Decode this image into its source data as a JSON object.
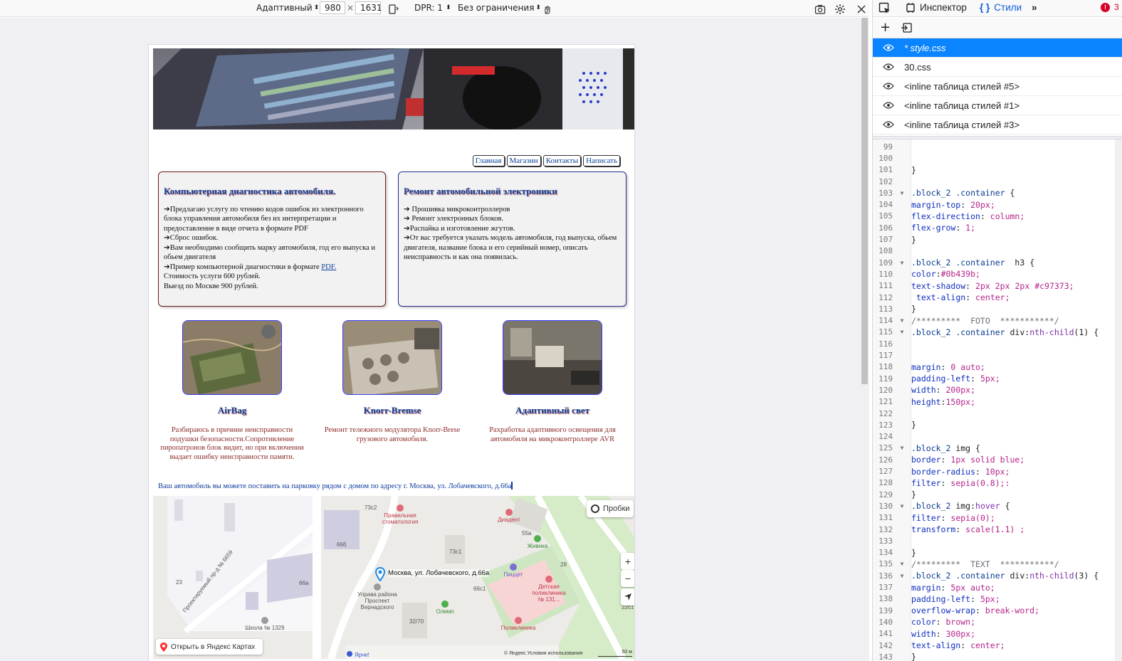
{
  "rdm": {
    "device": "Адаптивный",
    "width": "980",
    "times": "×",
    "height": "1631",
    "dpr": "DPR: 1",
    "throttle": "Без ограничения"
  },
  "site": {
    "nav": [
      "Главная",
      "Магазин",
      "Контакты",
      "Написать"
    ],
    "card_diag": {
      "title": "Компьютерная диагностика автомобиля.",
      "lines": [
        "➔Предлагаю услугу по чтению кодов ошибок из электронного блока управления автомобиля без их интерпретации и предоставление в виде отчета в формате PDF",
        "➔Сброс ошибок.",
        "➔Вам необходимо сообщить марку автомобиля, год его выпуска и обьем двигателя"
      ],
      "pdf_prefix": "➔Пример компьютерной диагностики в формате ",
      "pdf_link": "PDF.",
      "price1": "Стоимость услуги 600 рублей.",
      "price2": "Выезд по Москве 900 рублей."
    },
    "card_repair": {
      "title": "Ремонт автомобильной электроники",
      "lines": [
        "➔ Прошивка микроконтроллеров",
        "➔ Ремонт электронных блоков.",
        "➔Распайка и изготовление жгутов.",
        "➔От вас требуется указать модель автомобиля, год выпуска, обьем двигателя, название блока и его серийный номер, описать неисправность и как она появилась."
      ]
    },
    "photos": [
      {
        "title": "AirBag",
        "text": "Разбираюсь в причине неисправности подушки безопасности.Сопротивление пиропатронов блок видит, но при включении выдает ошибку неисправности памяти."
      },
      {
        "title": "Knorr-Bremse",
        "text": "Ремонт тележного модулятора Knorr-Brese грузового автомобиля."
      },
      {
        "title": "Адаптивный свет",
        "text": "Рахработка адаптивного освещения для автомобиля на микроконтроллере AVR"
      }
    ],
    "address": "Ваш автомобиль вы можете поставить на парковку рядом с домом по адресу г. Москва, ул. Лобачевского, д.66а",
    "map": {
      "marker_label": "Москва, ул. Лобачевского, д.66а",
      "traffic": "Пробки",
      "open_link": "Открыть в Яндекс Картах",
      "copyright": "© Яндекс   Условия использования",
      "scale": "50 м",
      "street": "Проектируемый пр-д № 6659",
      "labels": [
        "73с2",
        "66б",
        "73с1",
        "66а",
        "66с1",
        "32/70",
        "23",
        "55а",
        "28",
        "22с1"
      ],
      "pois": [
        "Правильная стоматология",
        "Диадент",
        "Живика",
        "Пиццет",
        "Детская поликлиника № 131...",
        "Поликлиника",
        "Олимп",
        "Управа района Проспект Вернадского",
        "Школа № 1329",
        "Ярче!"
      ]
    }
  },
  "devtools": {
    "inspector": "Инспектор",
    "styles": "Стили",
    "errors": "3",
    "sheets": [
      "* style.css",
      "30.css",
      "<inline таблица стилей #5>",
      "<inline таблица стилей #1>",
      "<inline таблица стилей #3>"
    ],
    "code_lines": [
      {
        "n": "99",
        "fold": "",
        "t": ""
      },
      {
        "n": "100",
        "fold": "",
        "t": ""
      },
      {
        "n": "101",
        "fold": "",
        "t": "}"
      },
      {
        "n": "102",
        "fold": "",
        "t": ""
      },
      {
        "n": "103",
        "fold": "▼",
        "t": ".block_2 .container {"
      },
      {
        "n": "104",
        "fold": "",
        "t": "margin-top: 20px;"
      },
      {
        "n": "105",
        "fold": "",
        "t": "flex-direction: column;"
      },
      {
        "n": "106",
        "fold": "",
        "t": "flex-grow: 1;"
      },
      {
        "n": "107",
        "fold": "",
        "t": "}"
      },
      {
        "n": "108",
        "fold": "",
        "t": ""
      },
      {
        "n": "109",
        "fold": "▼",
        "t": ".block_2 .container  h3 {"
      },
      {
        "n": "110",
        "fold": "",
        "t": "color:#0b439b;"
      },
      {
        "n": "111",
        "fold": "",
        "t": "text-shadow: 2px 2px 2px #c97373;"
      },
      {
        "n": "112",
        "fold": "",
        "t": " text-align: center;"
      },
      {
        "n": "113",
        "fold": "",
        "t": "}"
      },
      {
        "n": "114",
        "fold": "▼",
        "t": "/*********  FOTO  ***********/"
      },
      {
        "n": "115",
        "fold": "▼",
        "t": ".block_2 .container div:nth-child(1) {"
      },
      {
        "n": "116",
        "fold": "",
        "t": ""
      },
      {
        "n": "117",
        "fold": "",
        "t": ""
      },
      {
        "n": "118",
        "fold": "",
        "t": "margin: 0 auto;"
      },
      {
        "n": "119",
        "fold": "",
        "t": "padding-left: 5px;"
      },
      {
        "n": "120",
        "fold": "",
        "t": "width: 200px;"
      },
      {
        "n": "121",
        "fold": "",
        "t": "height:150px;"
      },
      {
        "n": "122",
        "fold": "",
        "t": ""
      },
      {
        "n": "123",
        "fold": "",
        "t": "}"
      },
      {
        "n": "124",
        "fold": "",
        "t": ""
      },
      {
        "n": "125",
        "fold": "▼",
        "t": ".block_2 img {"
      },
      {
        "n": "126",
        "fold": "",
        "t": "border: 1px solid blue;"
      },
      {
        "n": "127",
        "fold": "",
        "t": "border-radius: 10px;"
      },
      {
        "n": "128",
        "fold": "",
        "t": "filter: sepia(0.8);:"
      },
      {
        "n": "129",
        "fold": "",
        "t": "}"
      },
      {
        "n": "130",
        "fold": "▼",
        "t": ".block_2 img:hover {"
      },
      {
        "n": "131",
        "fold": "",
        "t": "filter: sepia(0);"
      },
      {
        "n": "132",
        "fold": "",
        "t": "transform: scale(1.1) ;"
      },
      {
        "n": "133",
        "fold": "",
        "t": ""
      },
      {
        "n": "134",
        "fold": "",
        "t": "}"
      },
      {
        "n": "135",
        "fold": "▼",
        "t": "/*********  TEXT  ***********/"
      },
      {
        "n": "136",
        "fold": "▼",
        "t": ".block_2 .container div:nth-child(3) {"
      },
      {
        "n": "137",
        "fold": "",
        "t": "margin: 5px auto;"
      },
      {
        "n": "138",
        "fold": "",
        "t": "padding-left: 5px;"
      },
      {
        "n": "139",
        "fold": "",
        "t": "overflow-wrap: break-word;"
      },
      {
        "n": "140",
        "fold": "",
        "t": "color: brown;"
      },
      {
        "n": "141",
        "fold": "",
        "t": "width: 300px;"
      },
      {
        "n": "142",
        "fold": "",
        "t": "text-align: center;"
      },
      {
        "n": "143",
        "fold": "",
        "t": "}"
      }
    ]
  },
  "colors": {
    "accent": "#0a84ff",
    "heading": "#0b439b",
    "shadow": "#c97373",
    "brown_text": "#8b2a2a"
  }
}
